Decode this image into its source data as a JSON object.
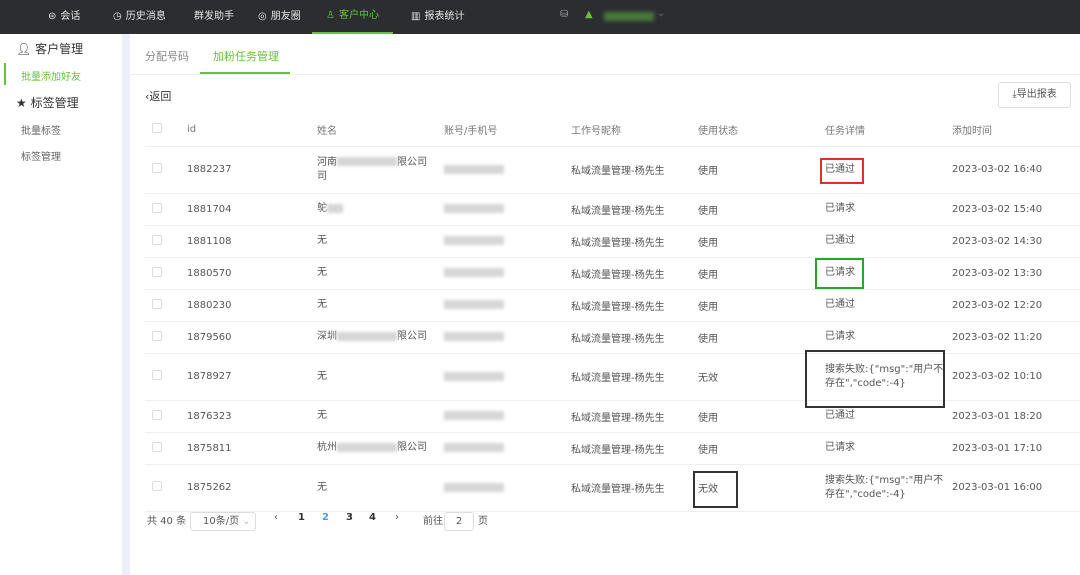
{
  "topnav": [
    {
      "label": "会话",
      "icon": "chat-icon"
    },
    {
      "label": "历史消息",
      "icon": "clock-icon"
    },
    {
      "label": "群发助手",
      "icon": ""
    },
    {
      "label": "朋友圈",
      "icon": "moments-icon"
    },
    {
      "label": "客户中心",
      "icon": "user-icon",
      "active": true
    },
    {
      "label": "报表统计",
      "icon": "bar-chart-icon"
    }
  ],
  "sidebar": {
    "group1": "客户管理",
    "item1": "批量添加好友",
    "group2": "标签管理",
    "item2": "批量标签",
    "item3": "标签管理"
  },
  "tabs": [
    "分配号码",
    "加粉任务管理"
  ],
  "back": "返回",
  "export": "导出报表",
  "columns": [
    "id",
    "姓名",
    "账号/手机号",
    "工作号昵称",
    "使用状态",
    "任务详情",
    "添加时间"
  ],
  "rows": [
    {
      "id": "1882237",
      "name": "河南",
      "name_suffix": "限公司",
      "name_line2": "司",
      "nick": "私域流量管理-杨先生",
      "use": "使用",
      "detail": "已通过",
      "time": "2023-03-02 16:40"
    },
    {
      "id": "1881704",
      "name": "鸵",
      "name_suffix": "",
      "name_line2": "",
      "nick": "私域流量管理-杨先生",
      "use": "使用",
      "detail": "已请求",
      "time": "2023-03-02 15:40"
    },
    {
      "id": "1881108",
      "name": "无",
      "name_suffix": "",
      "name_line2": "",
      "nick": "私域流量管理-杨先生",
      "use": "使用",
      "detail": "已通过",
      "time": "2023-03-02 14:30"
    },
    {
      "id": "1880570",
      "name": "无",
      "name_suffix": "",
      "name_line2": "",
      "nick": "私域流量管理-杨先生",
      "use": "使用",
      "detail": "已请求",
      "time": "2023-03-02 13:30"
    },
    {
      "id": "1880230",
      "name": "无",
      "name_suffix": "",
      "name_line2": "",
      "nick": "私域流量管理-杨先生",
      "use": "使用",
      "detail": "已通过",
      "time": "2023-03-02 12:20"
    },
    {
      "id": "1879560",
      "name": "深圳",
      "name_suffix": "限公司",
      "name_line2": "",
      "nick": "私域流量管理-杨先生",
      "use": "使用",
      "detail": "已请求",
      "time": "2023-03-02 11:20"
    },
    {
      "id": "1878927",
      "name": "无",
      "name_suffix": "",
      "name_line2": "",
      "nick": "私域流量管理-杨先生",
      "use": "无效",
      "detail": "搜索失败:{\"msg\":\"用户不存在\",\"code\":-4}",
      "time": "2023-03-02 10:10"
    },
    {
      "id": "1876323",
      "name": "无",
      "name_suffix": "",
      "name_line2": "",
      "nick": "私域流量管理-杨先生",
      "use": "使用",
      "detail": "已通过",
      "time": "2023-03-01 18:20"
    },
    {
      "id": "1875811",
      "name": "杭州",
      "name_suffix": "限公司",
      "name_line2": "",
      "nick": "私域流量管理-杨先生",
      "use": "使用",
      "detail": "已请求",
      "time": "2023-03-01 17:10"
    },
    {
      "id": "1875262",
      "name": "无",
      "name_suffix": "",
      "name_line2": "",
      "nick": "私域流量管理-杨先生",
      "use": "无效",
      "detail": "搜索失败:{\"msg\":\"用户不存在\",\"code\":-4}",
      "time": "2023-03-01 16:00"
    }
  ],
  "pagination": {
    "total": "共 40 条",
    "page_size": "10条/页",
    "pages": [
      "1",
      "2",
      "3",
      "4"
    ],
    "current": "2",
    "goto_label": "前往",
    "goto_value": "2",
    "page_suffix": "页"
  },
  "colors": {
    "accent": "#67c23a",
    "topbar": "#2b2d31"
  }
}
